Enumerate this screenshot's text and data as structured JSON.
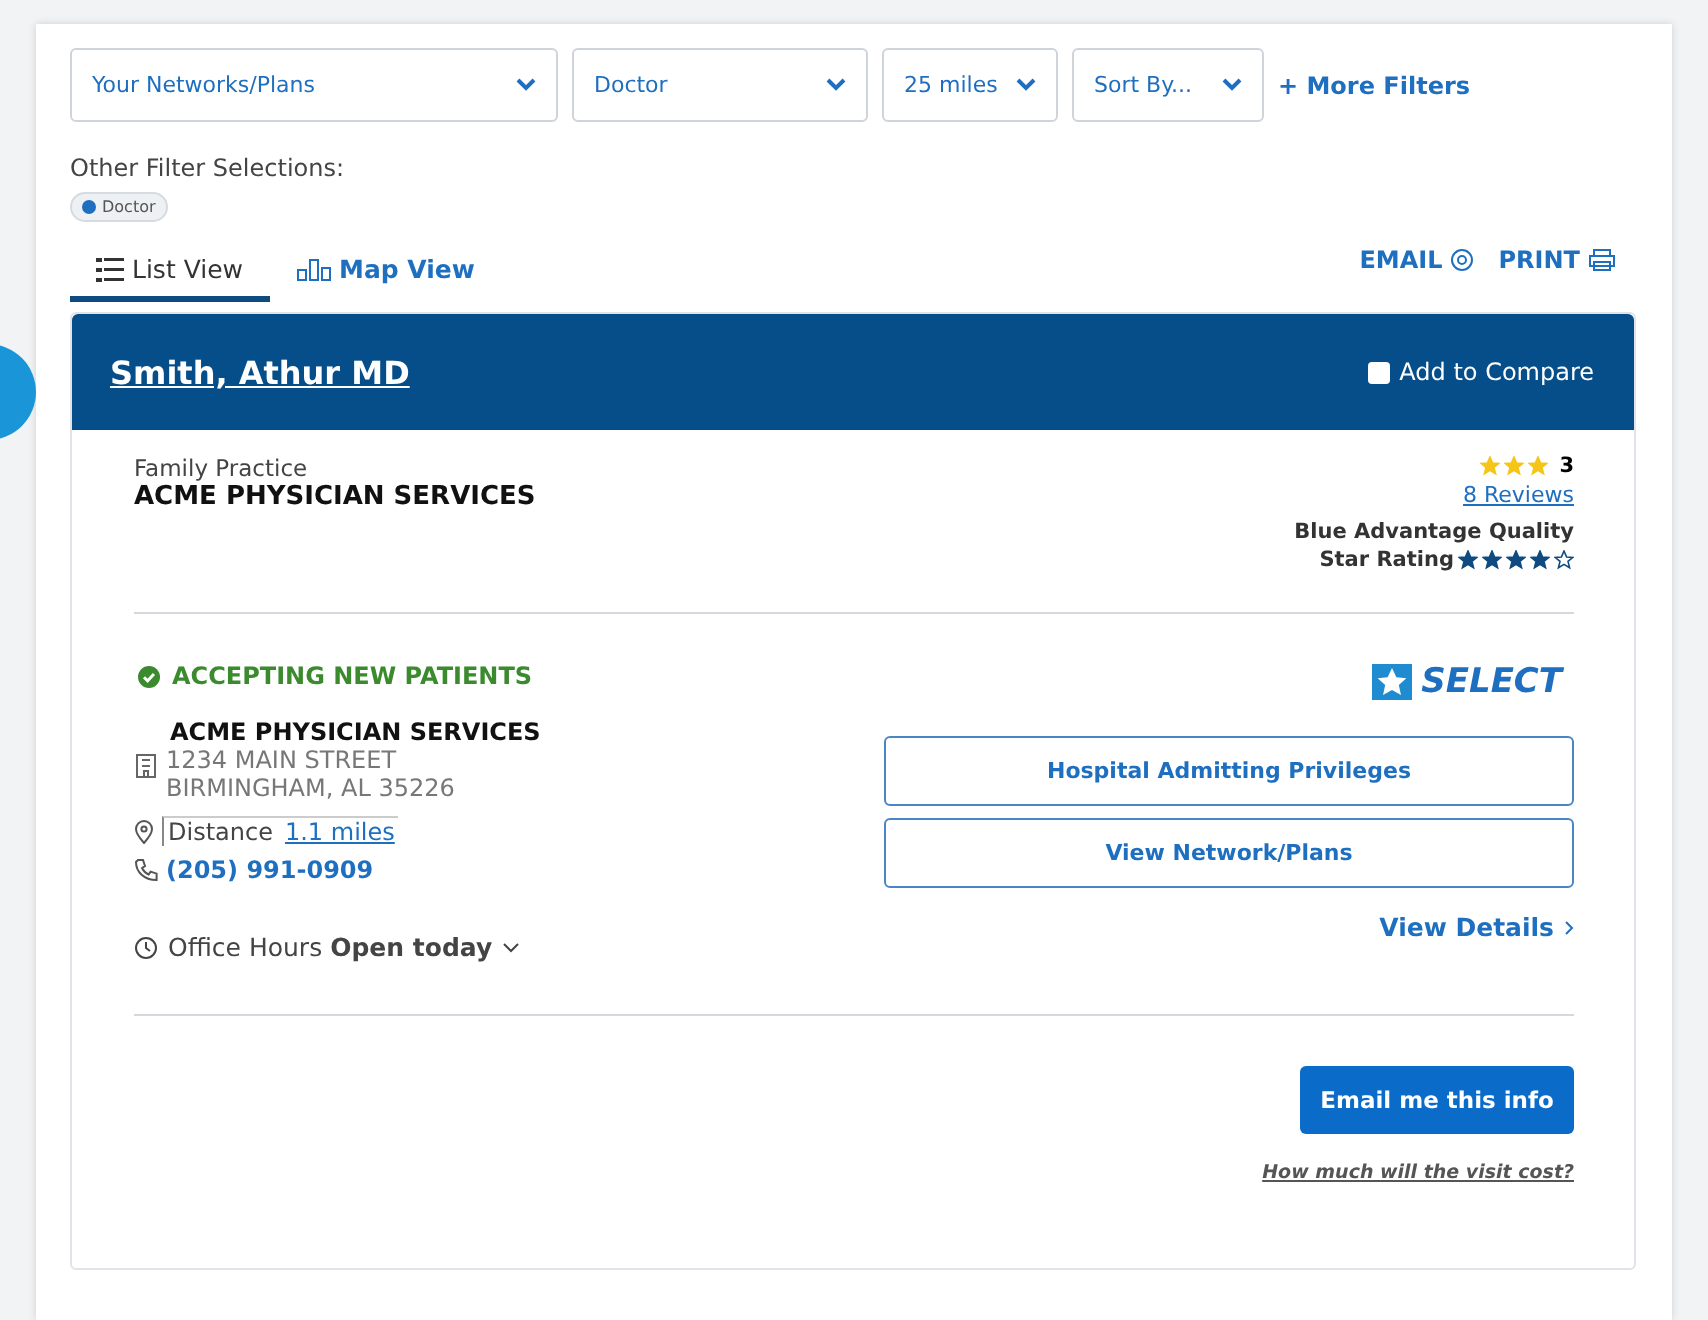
{
  "filters": [
    {
      "label": "Your Networks/Plans"
    },
    {
      "label": "Doctor"
    },
    {
      "label": "25 miles"
    },
    {
      "label": "Sort By..."
    }
  ],
  "more_filters": "+ More Filters",
  "other_filters": {
    "label": "Other Filter Selections:",
    "chips": [
      "Doctor"
    ]
  },
  "tabs": [
    {
      "label": "List View",
      "selected": true
    },
    {
      "label": "Map View",
      "selected": false
    }
  ],
  "actions": {
    "email": "EMAIL",
    "print": "PRINT"
  },
  "provider": {
    "name": "Smith, Athur MD",
    "compare": {
      "label": "Add to Compare",
      "checked": false
    },
    "specialty": "Family Practice",
    "group": "ACME PHYSICIAN SERVICES",
    "rating": {
      "stars": 3,
      "value": "3",
      "reviews": "8 Reviews"
    },
    "quality": {
      "line1": "Blue Advantage Quality",
      "line2": "Star Rating",
      "stars": 4
    },
    "status": "ACCEPTING NEW PATIENTS",
    "badge": "SELECT",
    "location": {
      "name": "ACME PHYSICIAN SERVICES",
      "street": "1234 MAIN STREET",
      "city": "BIRMINGHAM, AL 35226",
      "distance_label": "Distance",
      "distance": "1.1 miles",
      "phone": "(205) 991-0909"
    },
    "hours": {
      "label": "Office Hours",
      "status": "Open today"
    },
    "buttons": [
      "Hospital Admitting Privileges",
      "View Network/Plans"
    ],
    "details": "View Details",
    "email_button": "Email me this info",
    "cost_link": "How much will the visit cost?"
  }
}
